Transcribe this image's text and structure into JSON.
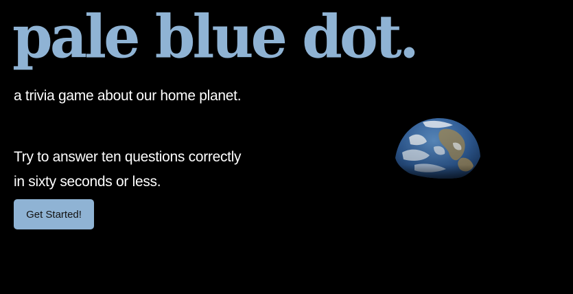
{
  "header": {
    "title": "pale blue dot.",
    "subtitle": "a trivia game about our home planet."
  },
  "intro": {
    "line1": "Try to answer ten questions correctly",
    "line2": "in sixty seconds or less."
  },
  "actions": {
    "start_label": "Get Started!"
  },
  "colors": {
    "background": "#000000",
    "accent": "#8fb3d4",
    "text": "#ffffff"
  },
  "image": {
    "icon": "earth-icon"
  }
}
